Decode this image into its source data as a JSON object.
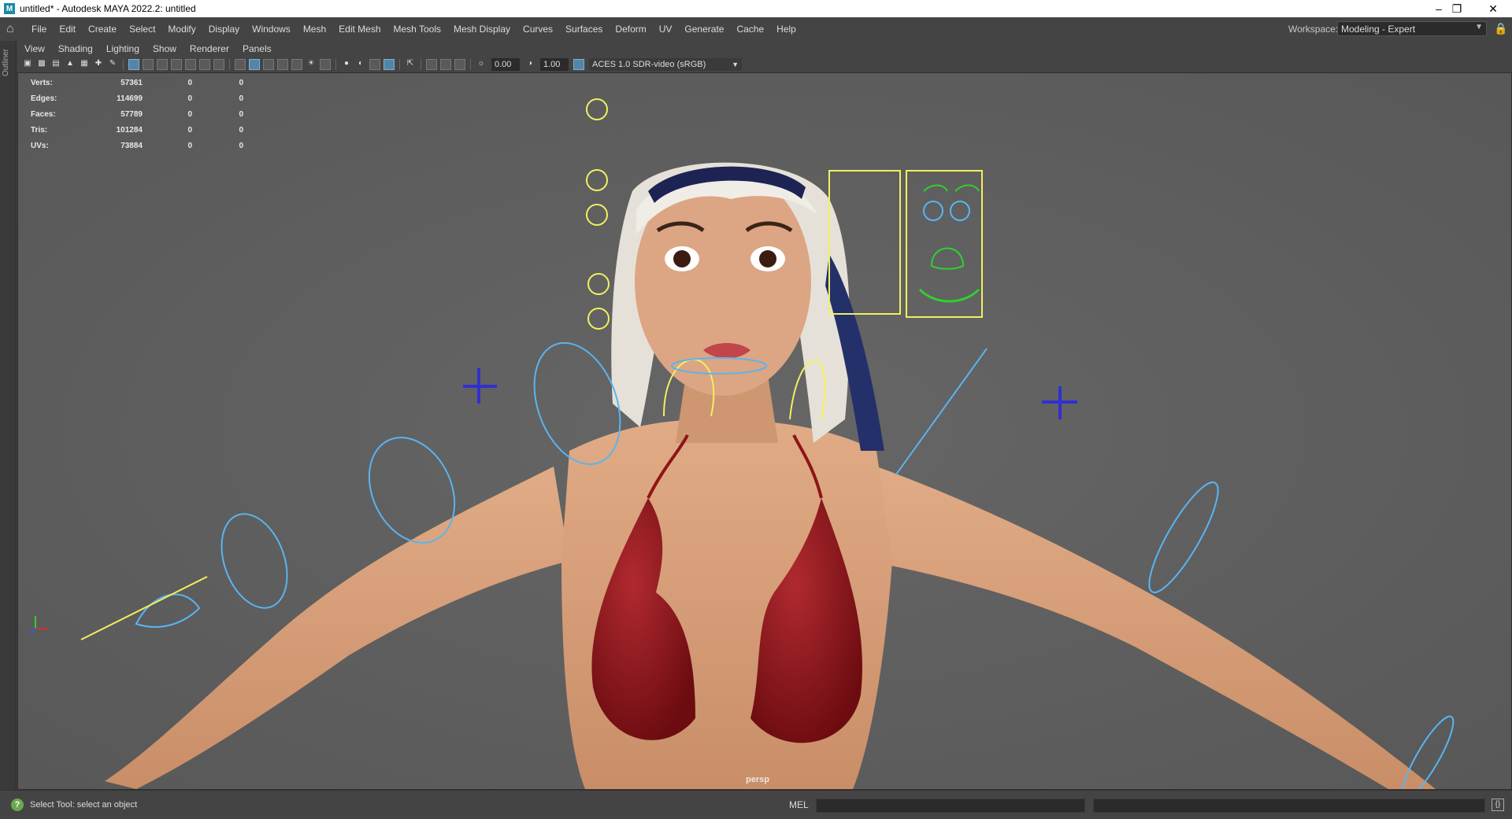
{
  "window": {
    "title": "untitled* - Autodesk MAYA 2022.2: untitled",
    "app_icon": "maya-icon",
    "controls": [
      "minimize-icon",
      "restore-icon",
      "close-icon"
    ]
  },
  "menubar": {
    "home_icon": "home-icon",
    "items": [
      "File",
      "Edit",
      "Create",
      "Select",
      "Modify",
      "Display",
      "Windows",
      "Mesh",
      "Edit Mesh",
      "Mesh Tools",
      "Mesh Display",
      "Curves",
      "Surfaces",
      "Deform",
      "UV",
      "Generate",
      "Cache",
      "Help"
    ],
    "workspace_label": "Workspace:",
    "workspace_value": "Modeling - Expert",
    "lock_icon": "lock-icon"
  },
  "outliner": {
    "label": "Outliner"
  },
  "panel_menu": {
    "items": [
      "View",
      "Shading",
      "Lighting",
      "Show",
      "Renderer",
      "Panels"
    ]
  },
  "panel_toolbar": {
    "exposure": "0.00",
    "gamma": "1.00",
    "color_space": "ACES 1.0 SDR-video (sRGB)"
  },
  "viewport": {
    "camera": "persp",
    "background": "#5e5e5e",
    "hud": {
      "rows": [
        {
          "label": "Verts:",
          "v1": "57361",
          "v2": "0",
          "v3": "0"
        },
        {
          "label": "Edges:",
          "v1": "114699",
          "v2": "0",
          "v3": "0"
        },
        {
          "label": "Faces:",
          "v1": "57789",
          "v2": "0",
          "v3": "0"
        },
        {
          "label": "Tris:",
          "v1": "101284",
          "v2": "0",
          "v3": "0"
        },
        {
          "label": "UVs:",
          "v1": "73884",
          "v2": "0",
          "v3": "0"
        }
      ]
    },
    "colors": {
      "skin": "#d9a27c",
      "bikini": "#8e1418",
      "hair": "#e6e1d8",
      "headband": "#1d2454",
      "ctrl_yellow": "#f0f060",
      "ctrl_cyan": "#5ab4f0",
      "ctrl_green": "#30d030",
      "ctrl_blue": "#3030d0"
    }
  },
  "statusbar": {
    "help_icon": "help-icon",
    "message": "Select Tool: select an object",
    "mel_label": "MEL",
    "script_icon": "script-editor-icon"
  }
}
